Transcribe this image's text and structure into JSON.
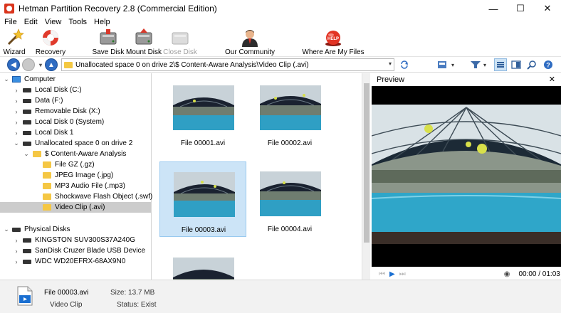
{
  "window": {
    "title": "Hetman Partition Recovery 2.8 (Commercial Edition)",
    "controls": {
      "minimize": "—",
      "maximize": "☐",
      "close": "✕"
    }
  },
  "menu": [
    "File",
    "Edit",
    "View",
    "Tools",
    "Help"
  ],
  "toolbar": {
    "wizard": "Wizard",
    "recovery": "Recovery",
    "save_disk": "Save Disk",
    "mount_disk": "Mount Disk",
    "close_disk": "Close Disk",
    "our_community": "Our Community",
    "where_are_my_files": "Where Are My Files"
  },
  "address": {
    "path": "Unallocated space 0 on drive 2\\$ Content-Aware Analysis\\Video Clip (.avi)"
  },
  "tree": {
    "computer": "Computer",
    "items": [
      "Local Disk (C:)",
      "Data (F:)",
      "Removable Disk (X:)",
      "Local Disk 0 (System)",
      "Local Disk 1",
      "Unallocated space 0 on drive 2",
      "$ Content-Aware Analysis",
      "File GZ (.gz)",
      "JPEG Image (.jpg)",
      "MP3 Audio File (.mp3)",
      "Shockwave Flash Object (.swf)",
      "Video Clip (.avi)"
    ],
    "physical": "Physical Disks",
    "physical_items": [
      "KINGSTON SUV300S37A240G",
      "SanDisk Cruzer Blade USB Device",
      "WDC WD20EFRX-68AX9N0"
    ]
  },
  "files": [
    {
      "name": "File 00001.avi"
    },
    {
      "name": "File 00002.avi"
    },
    {
      "name": "File 00003.avi"
    },
    {
      "name": "File 00004.avi"
    }
  ],
  "preview": {
    "title": "Preview",
    "close": "✕",
    "time": "00:00 / 01:03"
  },
  "status": {
    "file_name": "File 00003.avi",
    "file_type": "Video Clip",
    "size_label": "Size: 13.7 MB",
    "status_label": "Status: Exist"
  },
  "colors": {
    "selection": "#cce4f7",
    "tree_selection": "#cccccc",
    "water": "#2f9fc4",
    "accent": "#1a6fd1"
  }
}
